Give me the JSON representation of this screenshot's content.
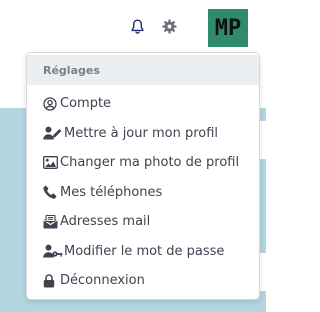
{
  "topbar": {
    "avatar_initials": "MP"
  },
  "dropdown": {
    "header": "Réglages",
    "items": [
      {
        "label": "Compte",
        "icon": "user-circle-icon"
      },
      {
        "label": "Mettre à jour mon profil",
        "icon": "user-edit-icon"
      },
      {
        "label": "Changer ma photo de profil",
        "icon": "image-icon"
      },
      {
        "label": "Mes téléphones",
        "icon": "phone-icon"
      },
      {
        "label": "Adresses mail",
        "icon": "envelope-icon"
      },
      {
        "label": "Modifier le mot de passe",
        "icon": "user-key-icon"
      },
      {
        "label": "Déconnexion",
        "icon": "lock-icon"
      }
    ]
  },
  "colors": {
    "bell": "#1f2a6b",
    "gear": "#6b6f75",
    "avatar_bg": "#2e8b6e",
    "background": "#b3d5e0",
    "menu_text": "#3d4450",
    "header_bg": "#eceff1"
  }
}
